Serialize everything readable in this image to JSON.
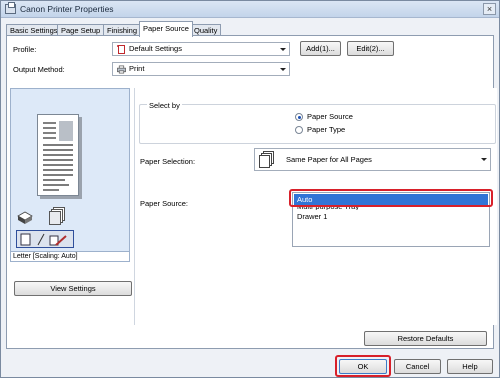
{
  "window": {
    "title": "Canon Printer Properties",
    "close_glyph": "×"
  },
  "tabs": [
    {
      "label": "Basic Settings"
    },
    {
      "label": "Page Setup"
    },
    {
      "label": "Finishing"
    },
    {
      "label": "Paper Source",
      "active": true
    },
    {
      "label": "Quality"
    }
  ],
  "profile": {
    "label": "Profile:",
    "value": "Default Settings",
    "icon": "profile-doc-icon",
    "add_label": "Add(1)...",
    "edit_label": "Edit(2)..."
  },
  "output_method": {
    "label": "Output Method:",
    "value": "Print",
    "icon": "printer-icon"
  },
  "preview": {
    "caption": "Letter [Scaling: Auto]",
    "view_settings_label": "View Settings"
  },
  "select_by": {
    "label": "Select by",
    "options": [
      {
        "label": "Paper Source",
        "checked": true
      },
      {
        "label": "Paper Type",
        "checked": false
      }
    ]
  },
  "paper_selection": {
    "label": "Paper Selection:",
    "value": "Same Paper for All Pages"
  },
  "paper_source": {
    "label": "Paper Source:",
    "items": [
      "Auto",
      "Multi-purpose Tray",
      "Drawer 1"
    ],
    "selected": "Auto"
  },
  "restore_defaults_label": "Restore Defaults",
  "footer": {
    "ok_label": "OK",
    "cancel_label": "Cancel",
    "help_label": "Help"
  },
  "colors": {
    "highlight": "#d8202a",
    "selection": "#3174d6",
    "preview_bg": "#dde9f8"
  }
}
